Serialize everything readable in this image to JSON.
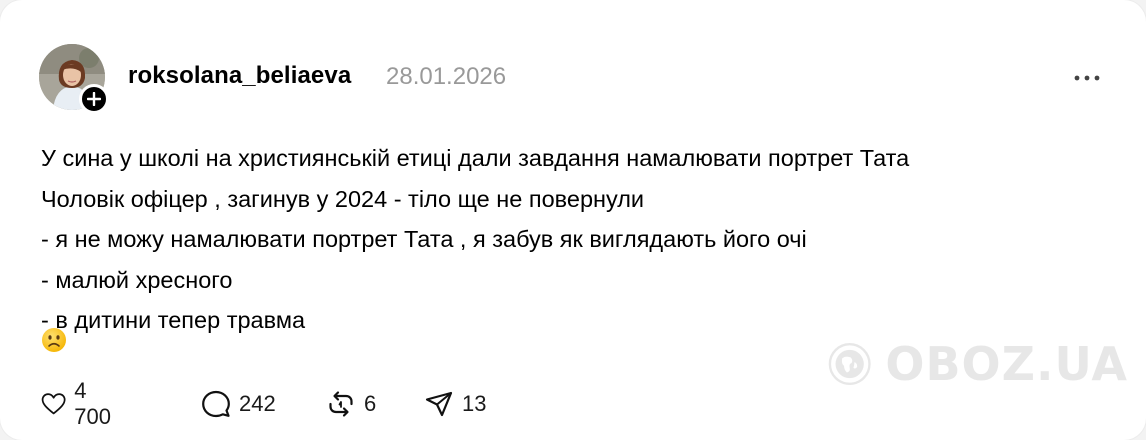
{
  "post": {
    "username": "roksolana_beliaeva",
    "date": "28.01.2026",
    "lines": [
      "У сина у школі на християнській етиці дали завдання намалювати портрет Тата",
      "Чоловік офіцер , загинув у 2024 - тіло ще не повернули",
      "- я не можу намалювати портрет Тата , я забув як виглядають його очі",
      "- малюй хресного",
      "- в дитини тепер травма"
    ],
    "emoji": "☹️"
  },
  "actions": {
    "likes": "4 700",
    "comments": "242",
    "reposts": "6",
    "shares": "13"
  },
  "icons": {
    "avatar": "profile-photo",
    "follow": "plus-icon",
    "more": "more-horizontal-icon",
    "like": "heart-icon",
    "comment": "speech-bubble-icon",
    "repost": "repost-icon",
    "share": "paper-plane-icon",
    "watermark": "globe-logo-icon"
  },
  "watermark": {
    "text": "OBOZ.UA"
  },
  "colors": {
    "text": "#000000",
    "muted": "#999999",
    "background": "#ffffff"
  }
}
